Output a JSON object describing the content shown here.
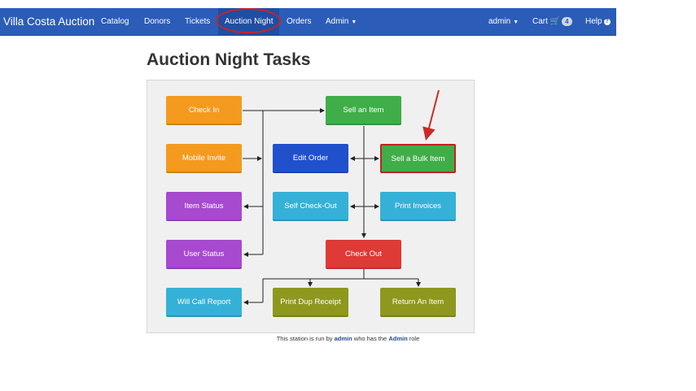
{
  "nav": {
    "brand": "Villa Costa Auction",
    "items": [
      "Catalog",
      "Donors",
      "Tickets",
      "Auction Night",
      "Orders",
      "Admin"
    ],
    "user": "admin",
    "cart_label": "Cart",
    "cart_count": "4",
    "help_label": "Help"
  },
  "page": {
    "title": "Auction Night Tasks"
  },
  "tasks": {
    "check_in": "Check In",
    "mobile_invite": "Mobile Invite",
    "item_status": "Item Status",
    "user_status": "User Status",
    "will_call_report": "Will Call Report",
    "sell_an_item": "Sell an Item",
    "edit_order": "Edit Order",
    "self_check_out": "Self Check-Out",
    "check_out": "Check Out",
    "print_dup_receipt": "Print Dup Receipt",
    "sell_a_bulk_item": "Sell a Bulk Item",
    "print_invoices": "Print Invoices",
    "return_an_item": "Return An Item"
  },
  "footer": {
    "prefix": "This station is run by",
    "user": "admin",
    "middle": "who has the",
    "role": "Admin",
    "suffix": "role"
  },
  "colors": {
    "navbar": "#2a5cb8",
    "orange": "#f39a1f",
    "green": "#3fae49",
    "blue": "#2050cc",
    "purple": "#a84ad0",
    "cyan": "#35b0d6",
    "red": "#e03a36",
    "olive": "#8f981e",
    "annotation": "#cc2222"
  }
}
